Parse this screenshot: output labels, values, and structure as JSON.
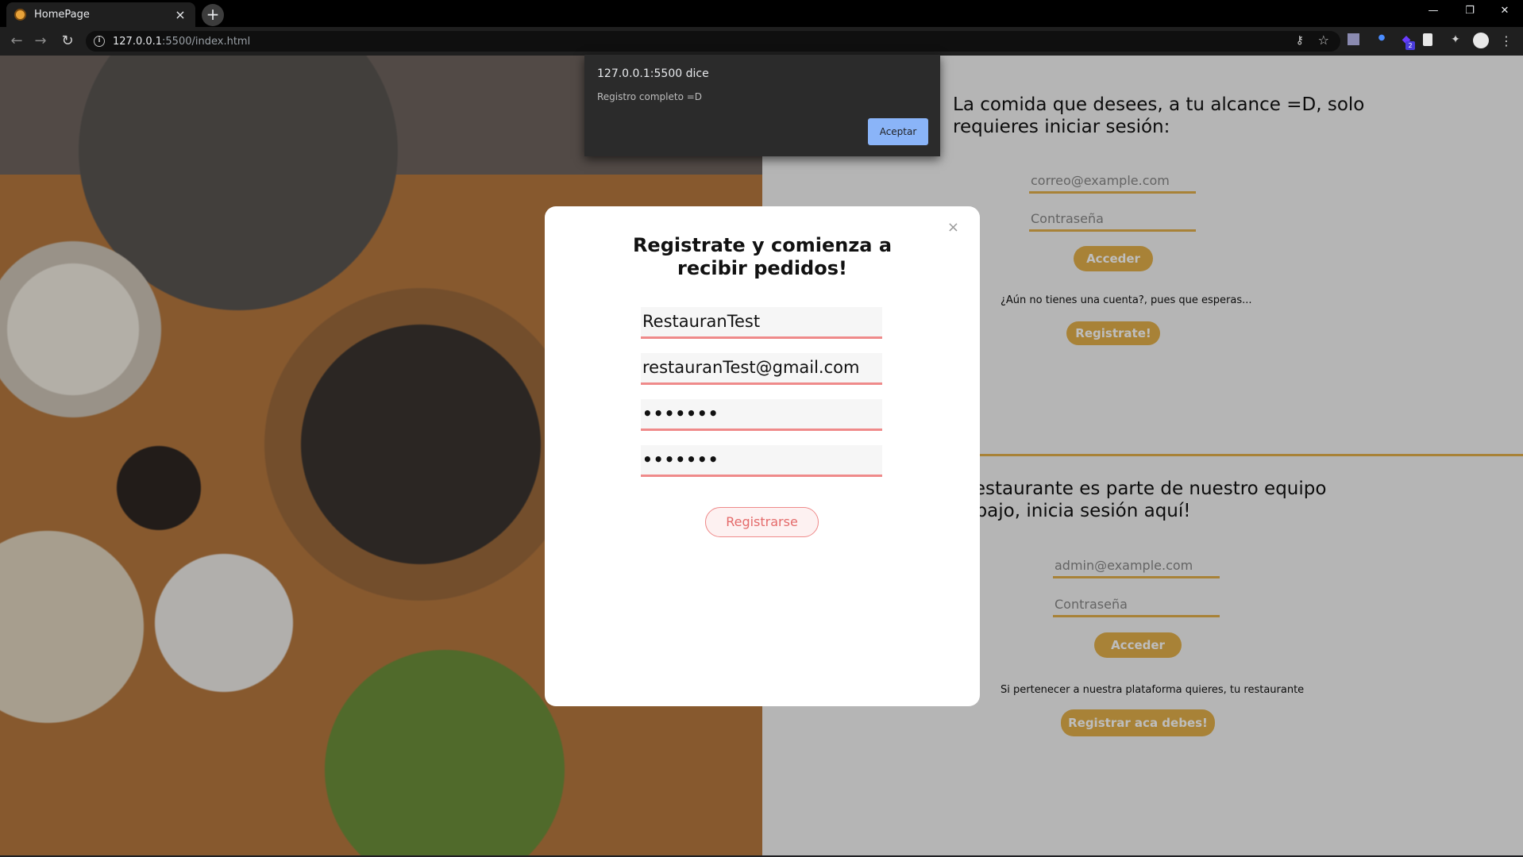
{
  "browser": {
    "tab_title": "HomePage",
    "tab_close": "×",
    "new_tab": "+",
    "url_host": "127.0.0.1",
    "url_path": ":5500/index.html",
    "back": "←",
    "forward": "→",
    "reload": "↻",
    "minimize": "—",
    "restore": "❐",
    "close": "✕",
    "extension_badge": "2"
  },
  "alert": {
    "title": "127.0.0.1:5500 dice",
    "message": "Registro completo =D",
    "accept_label": "Aceptar"
  },
  "customer_section": {
    "heading_line1": "La comida que desees, a tu alcance =D, solo",
    "heading_line2": "requieres iniciar sesión:",
    "email_placeholder": "correo@example.com",
    "password_placeholder": "Contraseña",
    "login_label": "Acceder",
    "no_account_text": "¿Aún no tienes una cuenta?, pues que esperas...",
    "register_label": "Registrate!"
  },
  "restaurant_section": {
    "heading_line1": "u restaurante es parte de nuestro equipo",
    "heading_line2": "trabajo, inicia sesión aquí!",
    "email_placeholder": "admin@example.com",
    "password_placeholder": "Contraseña",
    "login_label": "Acceder",
    "join_text": "Si pertenecer a nuestra plataforma quieres, tu restaurante",
    "register_label": "Registrar aca debes!"
  },
  "modal": {
    "close_label": "×",
    "title_line1": "Registrate y comienza a",
    "title_line2": "recibir pedidos!",
    "name_value": "RestauranTest",
    "email_value": "restauranTest@gmail.com",
    "password_value": "•••••••",
    "confirm_value": "•••••••",
    "submit_label": "Registrarse"
  },
  "colors": {
    "accent_gold": "#e3b04b",
    "accent_pink": "#ef8a8a",
    "dialog_button": "#8ab4f8"
  }
}
